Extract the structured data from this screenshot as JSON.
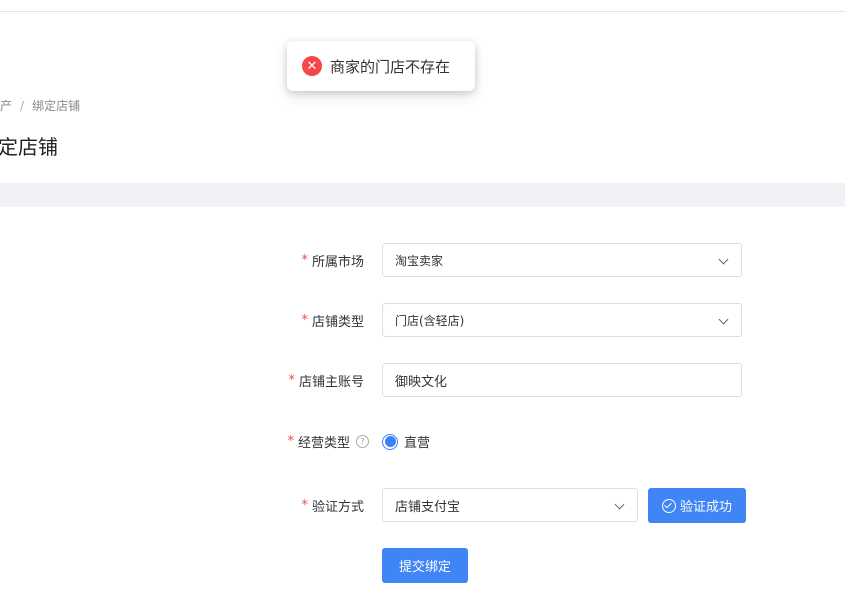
{
  "toast": {
    "message": "商家的门店不存在"
  },
  "breadcrumb": {
    "parent": "产",
    "separator": "/",
    "current": "绑定店铺"
  },
  "page": {
    "title": "定店铺"
  },
  "form": {
    "market": {
      "label": "所属市场",
      "value": "淘宝卖家"
    },
    "store_type": {
      "label": "店铺类型",
      "value": "门店(含轻店)"
    },
    "main_account": {
      "label": "店铺主账号",
      "value": "御映文化"
    },
    "business_type": {
      "label": "经营类型",
      "option": "直营"
    },
    "verify_method": {
      "label": "验证方式",
      "value": "店铺支付宝"
    },
    "required_mark": "*",
    "verify_button": "验证成功",
    "submit_button": "提交绑定"
  },
  "colors": {
    "accent": "#4085f5",
    "error": "#f5474a",
    "band": "#f0f2f5"
  }
}
